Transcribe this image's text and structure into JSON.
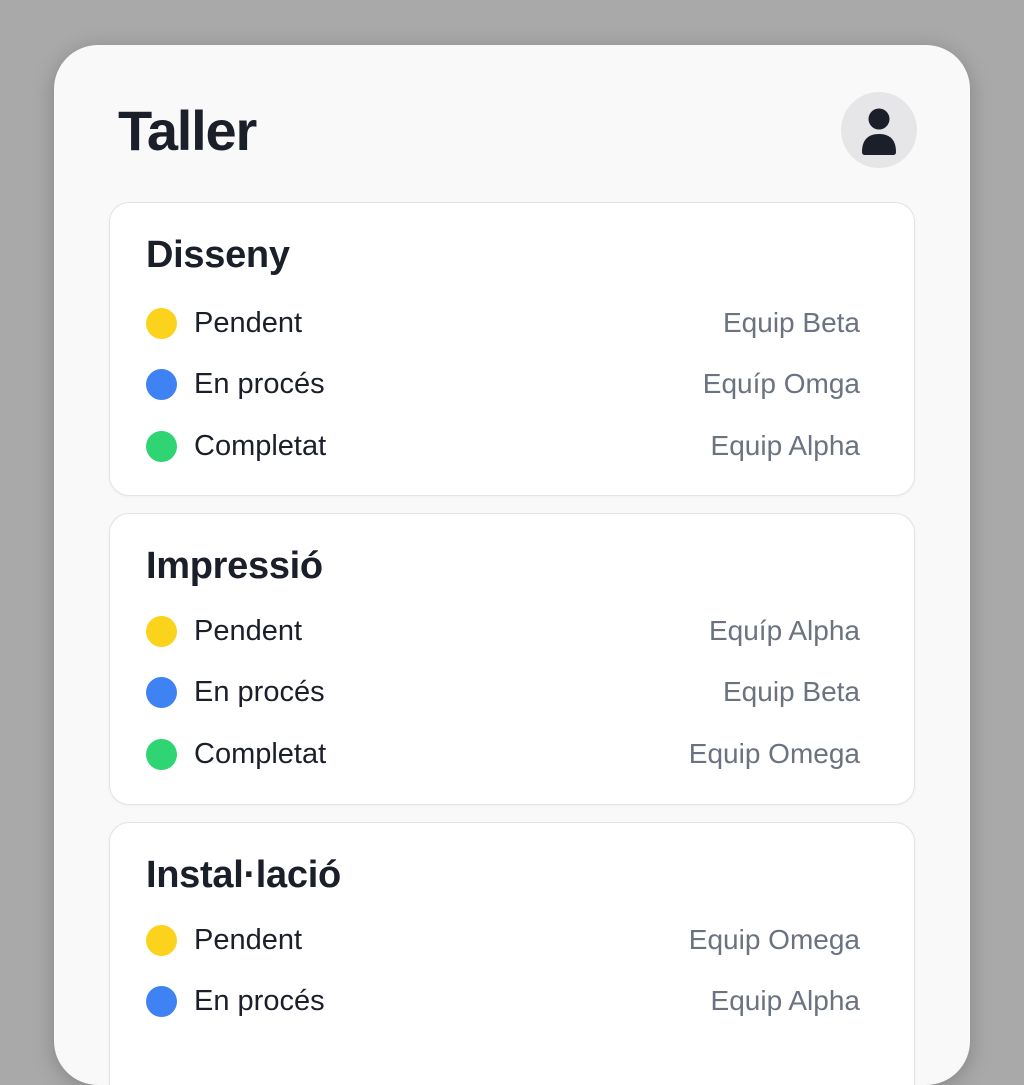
{
  "header": {
    "title": "Taller",
    "avatar_icon": "user-icon"
  },
  "status_colors": {
    "pending": "#fcd31c",
    "in_progress": "#3f82f4",
    "completed": "#2fd573"
  },
  "sections": [
    {
      "title": "Disseny",
      "items": [
        {
          "status": "Pendent",
          "team": "Equip Beta"
        },
        {
          "status": "En procés",
          "team": "Equíp Omga"
        },
        {
          "status": "Completat",
          "team": "Equip Alpha"
        }
      ]
    },
    {
      "title": "Impressió",
      "items": [
        {
          "status": "Pendent",
          "team": "Equíp Alpha"
        },
        {
          "status": "En procés",
          "team": "Equip Beta"
        },
        {
          "status": "Completat",
          "team": "Equip Omega"
        }
      ]
    },
    {
      "title": "Instal·lació",
      "items": [
        {
          "status": "Pendent",
          "team": "Equip Omega"
        },
        {
          "status": "En procés",
          "team": "Equip Alpha"
        }
      ]
    }
  ]
}
